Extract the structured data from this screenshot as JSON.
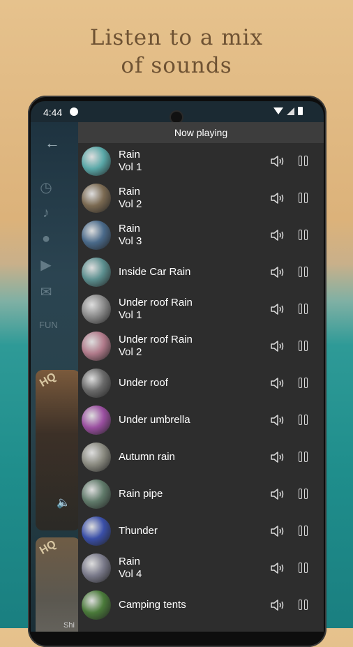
{
  "headline": {
    "line1": "Listen to a mix",
    "line2": "of sounds"
  },
  "status": {
    "time": "4:44"
  },
  "panel": {
    "title": "Now playing"
  },
  "sidebar": {
    "fun_label": "FUN",
    "card_badge": "HQ",
    "card2_text": "Shi"
  },
  "sounds": [
    {
      "line1": "Rain",
      "line2": "Vol 1",
      "color": "#5aa8a8"
    },
    {
      "line1": "Rain",
      "line2": "Vol 2",
      "color": "#7b6a52"
    },
    {
      "line1": "Rain",
      "line2": "Vol 3",
      "color": "#4a6a8a"
    },
    {
      "line1": "Inside Car Rain",
      "line2": "",
      "color": "#5c8f8f"
    },
    {
      "line1": "Under roof Rain",
      "line2": "Vol 1",
      "color": "#8a8a8a"
    },
    {
      "line1": "Under roof Rain",
      "line2": "Vol 2",
      "color": "#b07a8a"
    },
    {
      "line1": "Under roof",
      "line2": "",
      "color": "#6a6a6a"
    },
    {
      "line1": "Under umbrella",
      "line2": "",
      "color": "#9a4fa0"
    },
    {
      "line1": "Autumn rain",
      "line2": "",
      "color": "#8a8a80"
    },
    {
      "line1": "Rain pipe",
      "line2": "",
      "color": "#607a6a"
    },
    {
      "line1": "Thunder",
      "line2": "",
      "color": "#3a4fa8"
    },
    {
      "line1": "Rain",
      "line2": "Vol 4",
      "color": "#7a7a8a"
    },
    {
      "line1": "Camping tents",
      "line2": "",
      "color": "#4a7a3a"
    }
  ]
}
